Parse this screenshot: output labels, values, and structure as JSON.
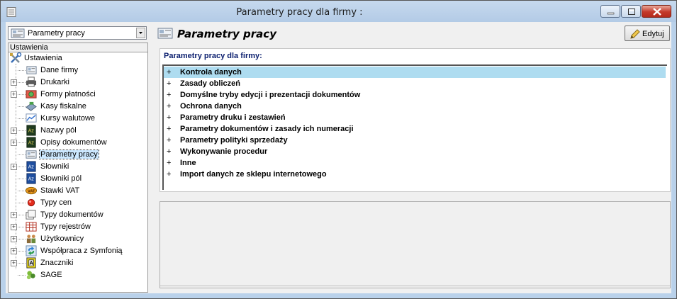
{
  "window": {
    "title": "Parametry pracy dla firmy :"
  },
  "left_panel": {
    "combo_value": "Parametry pracy",
    "tree_header": "Ustawienia",
    "tree_root": "Ustawienia",
    "items": [
      {
        "label": "Dane firmy",
        "icon": "company-card-icon",
        "expandable": false
      },
      {
        "label": "Drukarki",
        "icon": "printer-icon",
        "expandable": true
      },
      {
        "label": "Formy płatności",
        "icon": "payment-icon",
        "expandable": true
      },
      {
        "label": "Kasy fiskalne",
        "icon": "cash-register-icon",
        "expandable": false
      },
      {
        "label": "Kursy walutowe",
        "icon": "chart-icon",
        "expandable": false
      },
      {
        "label": "Nazwy pól",
        "icon": "az-dark-icon",
        "expandable": true
      },
      {
        "label": "Opisy dokumentów",
        "icon": "az-dark-icon",
        "expandable": true
      },
      {
        "label": "Parametry pracy",
        "icon": "settings-card-icon",
        "expandable": false,
        "selected": true
      },
      {
        "label": "Słowniki",
        "icon": "az-blue-icon",
        "expandable": true
      },
      {
        "label": "Słowniki pól",
        "icon": "az-blue-icon",
        "expandable": false
      },
      {
        "label": "Stawki VAT",
        "icon": "vat-icon",
        "expandable": false
      },
      {
        "label": "Typy cen",
        "icon": "red-dot-icon",
        "expandable": false
      },
      {
        "label": "Typy dokumentów",
        "icon": "documents-icon",
        "expandable": true
      },
      {
        "label": "Typy rejestrów",
        "icon": "register-icon",
        "expandable": true
      },
      {
        "label": "Użytkownicy",
        "icon": "users-icon",
        "expandable": true
      },
      {
        "label": "Współpraca z Symfonią",
        "icon": "sync-icon",
        "expandable": true
      },
      {
        "label": "Znaczniki",
        "icon": "tag-icon",
        "expandable": true
      },
      {
        "label": "SAGE",
        "icon": "sage-icon",
        "expandable": false
      }
    ]
  },
  "right_panel": {
    "title": "Parametry pracy",
    "edit_label": "Edytuj",
    "group_title": "Parametry pracy dla firmy:",
    "expander_symbol": "+",
    "items": [
      "Kontrola danych",
      "Zasady obliczeń",
      "Domyślne tryby edycji i prezentacji dokumentów",
      "Ochrona danych",
      "Parametry druku i zestawień",
      "Parametry dokumentów i zasady ich numeracji",
      "Parametry polityki sprzedaży",
      "Wykonywanie procedur",
      "Inne",
      "Import danych ze sklepu internetowego"
    ],
    "selected_index": 0
  },
  "colors": {
    "selection": "#aedcf0",
    "tree_selection": "#cce8ff",
    "title_bar": "#b9d1ea",
    "close_button": "#c4392a"
  }
}
